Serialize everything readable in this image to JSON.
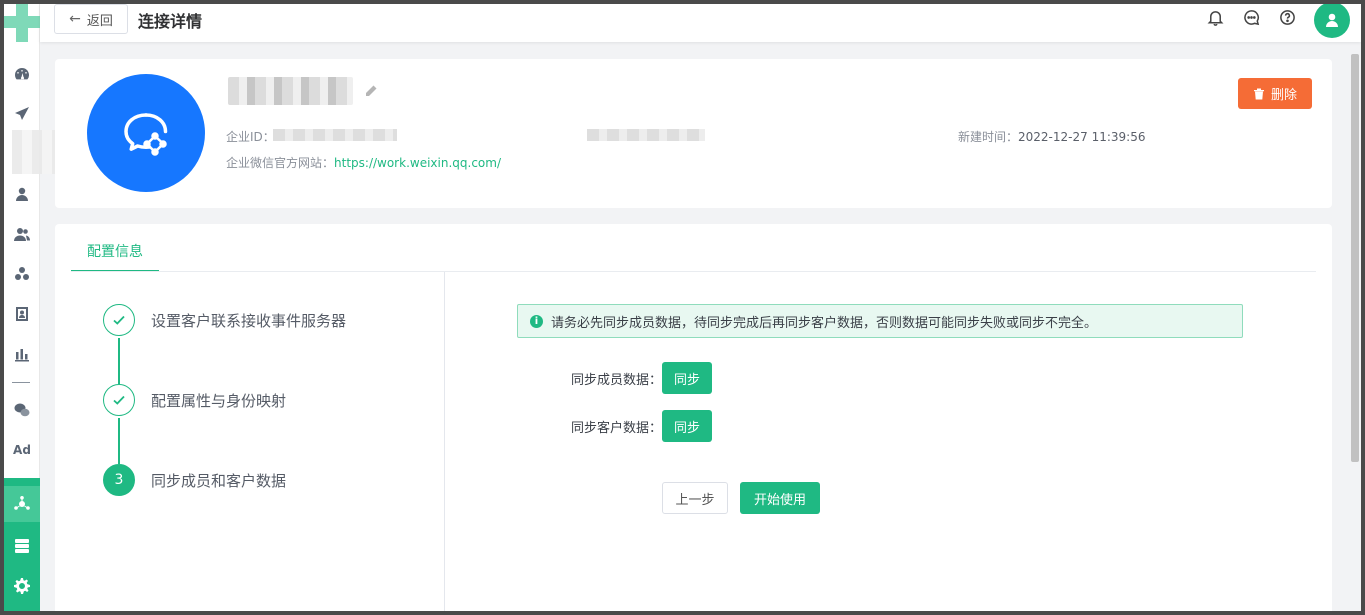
{
  "header": {
    "back_label": "返回",
    "title": "连接详情"
  },
  "corp": {
    "id_label": "企业ID：",
    "site_label": "企业微信官方网站：",
    "site_url": "https://work.weixin.qq.com/",
    "created_label": "新建时间：",
    "created_value": "2022-12-27 11:39:56",
    "delete_label": "删除"
  },
  "config": {
    "tab_label": "配置信息",
    "steps": [
      {
        "label": "设置客户联系接收事件服务器",
        "status": "done"
      },
      {
        "label": "配置属性与身份映射",
        "status": "done"
      },
      {
        "label": "同步成员和客户数据",
        "status": "active",
        "number": "3"
      }
    ],
    "alert_icon": "i",
    "alert_text": "请务必先同步成员数据，待同步完成后再同步客户数据，否则数据可能同步失败或同步不完全。",
    "sync_members_label": "同步成员数据：",
    "sync_members_button": "同步",
    "sync_customers_label": "同步客户数据：",
    "sync_customers_button": "同步",
    "prev_button": "上一步",
    "start_button": "开始使用"
  },
  "sidebar": {
    "ad_label": "Ad"
  },
  "colors": {
    "accent": "#1fb983",
    "danger": "#f56c36",
    "corp_logo": "#1677ff"
  }
}
